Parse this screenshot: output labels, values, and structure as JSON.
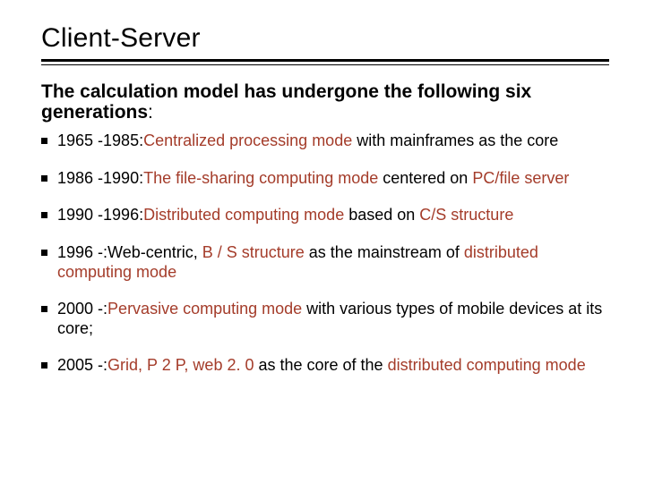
{
  "title": "Client-Server",
  "intro_prefix": " The calculation model has undergone the following six generations",
  "intro_colon": ":",
  "items": [
    {
      "range": "1965 -1985:",
      "hl1": "Centralized processing mode",
      "mid1": " with mainframes as the ",
      "hl2": "",
      "mid2": "",
      "hl3": "",
      "tail": "core"
    },
    {
      "range": "1986 -1990:",
      "hl1": "The file-sharing computing mode",
      "mid1": " centered on ",
      "hl2": "PC/file server",
      "mid2": "",
      "hl3": "",
      "tail": ""
    },
    {
      "range": "1990 -1996:",
      "hl1": "Distributed computing mode",
      "mid1": " based on ",
      "hl2": "C/S structure",
      "mid2": "",
      "hl3": "",
      "tail": ""
    },
    {
      "range": "1996 -:",
      "hl1": "",
      "mid1": "Web-centric, ",
      "hl2": "B / S structure",
      "mid2": " as the mainstream of ",
      "hl3": "distributed computing mode",
      "tail": ""
    },
    {
      "range": "2000 -:",
      "hl1": "Pervasive computing mode",
      "mid1": " with various types of mobile devices at its core;",
      "hl2": "",
      "mid2": "",
      "hl3": "",
      "tail": ""
    },
    {
      "range": "2005 -:",
      "hl1": "Grid, P 2 P, web 2. 0",
      "mid1": " as the core of the ",
      "hl2": "distributed computing mode",
      "mid2": "",
      "hl3": "",
      "tail": ""
    }
  ]
}
